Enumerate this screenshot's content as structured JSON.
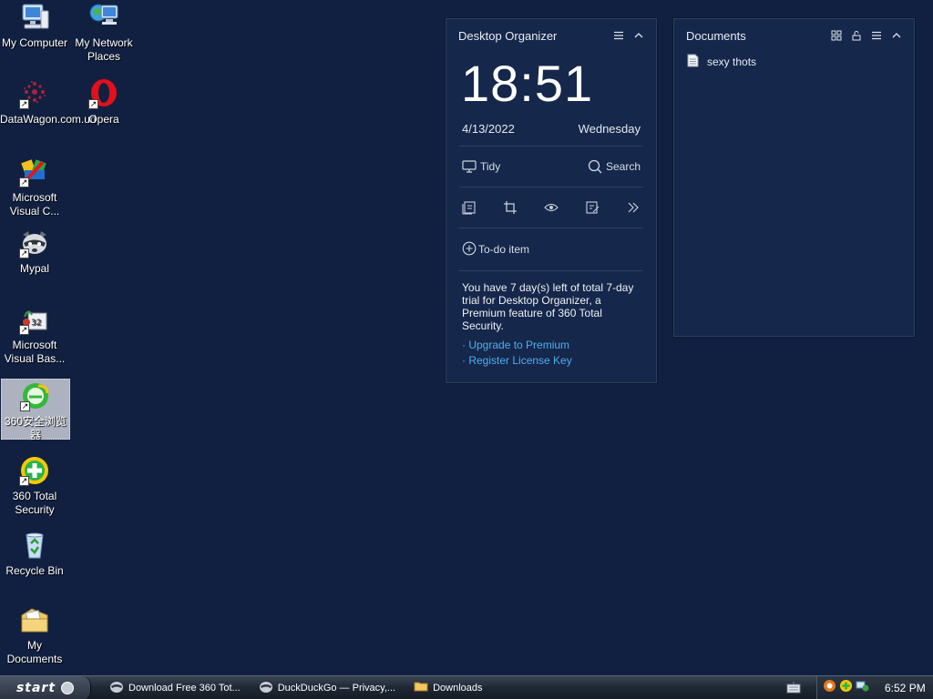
{
  "desktop_icons": [
    {
      "label": "My Computer",
      "icon": "computer-icon"
    },
    {
      "label": "My Network Places",
      "icon": "network-icon"
    },
    {
      "label": "DataWagon.com.url",
      "icon": "datawagon-icon"
    },
    {
      "label": "Opera",
      "icon": "opera-icon"
    },
    {
      "label": "Microsoft Visual C...",
      "icon": "visual-c-icon"
    },
    {
      "label": "Mypal",
      "icon": "mypal-icon"
    },
    {
      "label": "Microsoft Visual Bas...",
      "icon": "visual-basic-icon"
    },
    {
      "label": "360安全浏览器",
      "icon": "360-browser-icon"
    },
    {
      "label": "360 Total Security",
      "icon": "360-security-icon"
    },
    {
      "label": "Recycle Bin",
      "icon": "recycle-bin-icon"
    },
    {
      "label": "My Documents",
      "icon": "my-documents-icon"
    }
  ],
  "organizer": {
    "title": "Desktop Organizer",
    "time": "18:51",
    "date": "4/13/2022",
    "weekday": "Wednesday",
    "tidy_label": "Tidy",
    "search_label": "Search",
    "todo_label": "To-do item",
    "trial_text": "You have 7 day(s) left of total 7-day trial for Desktop Organizer, a Premium feature of 360 Total Security.",
    "upgrade_link": "· Upgrade to Premium",
    "register_link": "· Register License Key"
  },
  "documents_panel": {
    "title": "Documents",
    "items": [
      {
        "name": "sexy thots"
      }
    ]
  },
  "taskbar": {
    "start_label": "start",
    "buttons": [
      {
        "label": "Download Free 360 Tot..."
      },
      {
        "label": "DuckDuckGo — Privacy,..."
      },
      {
        "label": "Downloads"
      }
    ],
    "clock": "6:52 PM"
  },
  "colors": {
    "desktop_bg": "#112040",
    "panel_bg": "#15274a",
    "link": "#4ab0f2"
  }
}
